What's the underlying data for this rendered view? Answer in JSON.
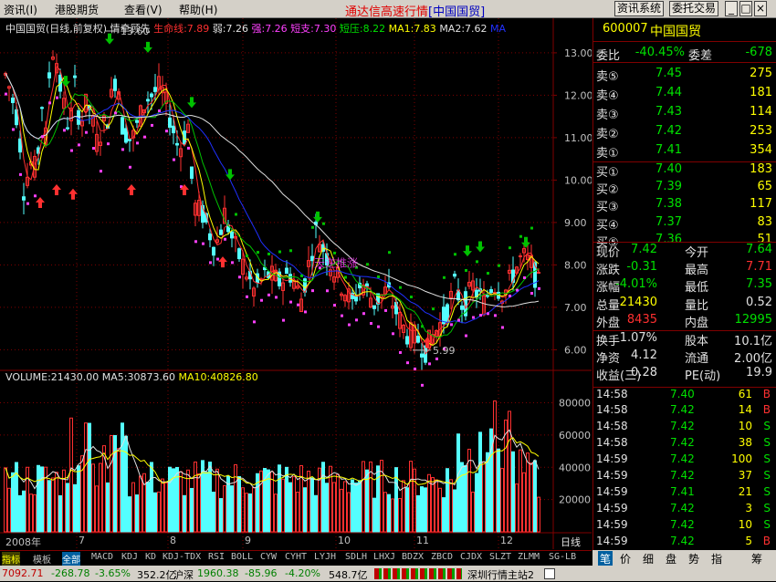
{
  "menu": {
    "items": [
      "资讯(I)",
      "港股期货",
      "查看(V)",
      "帮助(H)"
    ],
    "title": "通达信高速行情",
    "title_tag": "[中国国贸]",
    "btn1": "资讯系统",
    "btn2": "委托交易"
  },
  "chart": {
    "info": {
      "name": "中国国贸(日线,前复权) 情牵顾先",
      "life": "生命线:7.89",
      "weak": "弱:7.26",
      "strong": "强:7.26",
      "short": "短支:7.30",
      "pressure": "短压:8.22",
      "ma1": "MA1:7.83",
      "ma2": "MA2:7.62",
      "ma3": "MA"
    },
    "vol": {
      "volume": "VOLUME:21430.00",
      "ma5": "MA5:30873.60",
      "ma10": "MA10:40826.80"
    },
    "price_ticks": [
      "13.00",
      "12.00",
      "11.00",
      "10.00",
      "9.00",
      "8.00",
      "7.00",
      "6.00"
    ],
    "vol_ticks": [
      "80000",
      "60000",
      "40000",
      "20000"
    ],
    "x_labels": [
      "2008年",
      "7",
      "8",
      "9",
      "10",
      "11",
      "12",
      "日线"
    ],
    "annotations": {
      "high": "13.60",
      "low": "5.99",
      "watermark": "天逆推涨"
    }
  },
  "chart_data": {
    "type": "candlestick",
    "x_labels": [
      "2008年",
      "7",
      "8",
      "9",
      "10",
      "11",
      "12"
    ],
    "price_range": [
      5.6,
      13.6
    ],
    "volume_range": [
      0,
      95000
    ],
    "last": {
      "close": 7.42,
      "volume": 21430,
      "vol_ma5": 30873.6,
      "vol_ma10": 40826.8
    },
    "high": 13.6,
    "low": 5.99
  },
  "bottom_tabs": [
    "指标",
    "模板",
    "全部",
    "MACD",
    "KDJ",
    "KD",
    "KDJ-TDX",
    "RSI",
    "BOLL",
    "CYW",
    "CYHT",
    "LYJH",
    "SDLH",
    "LHXJ",
    "BDZX",
    "ZBCD",
    "CJDX",
    "SLZT",
    "ZLMM",
    "SG-LB"
  ],
  "quote": {
    "code": "600007",
    "name": "中国国贸",
    "wb_label": "委比",
    "wb": "-40.45%",
    "wc_label": "委差",
    "wc": "-678",
    "asks": [
      {
        "l": "卖⑤",
        "p": "7.45",
        "v": "275"
      },
      {
        "l": "卖④",
        "p": "7.44",
        "v": "181"
      },
      {
        "l": "卖③",
        "p": "7.43",
        "v": "114"
      },
      {
        "l": "卖②",
        "p": "7.42",
        "v": "253"
      },
      {
        "l": "卖①",
        "p": "7.41",
        "v": "354"
      }
    ],
    "bids": [
      {
        "l": "买①",
        "p": "7.40",
        "v": "183"
      },
      {
        "l": "买②",
        "p": "7.39",
        "v": "65"
      },
      {
        "l": "买③",
        "p": "7.38",
        "v": "117"
      },
      {
        "l": "买④",
        "p": "7.37",
        "v": "83"
      },
      {
        "l": "买⑤",
        "p": "7.36",
        "v": "51"
      }
    ],
    "stats": [
      {
        "a": "现价",
        "av": "7.42",
        "b": "今开",
        "bv": "7.64"
      },
      {
        "a": "涨跌",
        "av": "-0.31",
        "b": "最高",
        "bv": "7.71"
      },
      {
        "a": "涨幅",
        "av": "-4.01%",
        "b": "最低",
        "bv": "7.35"
      },
      {
        "a": "总量",
        "av": "21430",
        "b": "量比",
        "bv": "0.52"
      },
      {
        "a": "外盘",
        "av": "8435",
        "b": "内盘",
        "bv": "12995"
      }
    ],
    "stats2": [
      {
        "a": "换手",
        "av": "1.07%",
        "b": "股本",
        "bv": "10.1亿"
      },
      {
        "a": "净资",
        "av": "4.12",
        "b": "流通",
        "bv": "2.00亿"
      },
      {
        "a": "收益(三)",
        "av": "0.28",
        "b": "PE(动)",
        "bv": "19.9"
      }
    ],
    "ticks": [
      {
        "t": "14:58",
        "p": "7.40",
        "v": "61",
        "s": "B"
      },
      {
        "t": "14:58",
        "p": "7.42",
        "v": "14",
        "s": "B"
      },
      {
        "t": "14:58",
        "p": "7.42",
        "v": "10",
        "s": "S"
      },
      {
        "t": "14:58",
        "p": "7.42",
        "v": "38",
        "s": "S"
      },
      {
        "t": "14:59",
        "p": "7.42",
        "v": "100",
        "s": "S"
      },
      {
        "t": "14:59",
        "p": "7.42",
        "v": "37",
        "s": "S"
      },
      {
        "t": "14:59",
        "p": "7.41",
        "v": "21",
        "s": "S"
      },
      {
        "t": "14:59",
        "p": "7.42",
        "v": "3",
        "s": "S"
      },
      {
        "t": "14:59",
        "p": "7.42",
        "v": "10",
        "s": "S"
      },
      {
        "t": "14:59",
        "p": "7.42",
        "v": "5",
        "s": "B"
      }
    ]
  },
  "rp_tabs": [
    "笔",
    "价",
    "细",
    "盘",
    "势",
    "指",
    "筹"
  ],
  "status": {
    "idx1": "7092.71",
    "idx1_chg": "-268.78",
    "idx1_pct": "-3.65%",
    "idx1_amt": "352.2亿",
    "idx2_label": "沪深",
    "idx2": "1960.38",
    "idx2_chg": "-85.96",
    "idx2_pct": "-4.20%",
    "idx2_amt": "548.7亿",
    "server": "深圳行情主站2"
  },
  "colors": {
    "up": "#ff3030",
    "down": "#54ffff",
    "ma_white": "#e0e0e0",
    "ma_yellow": "#ffff00",
    "ma_blue": "#2030ff",
    "ma_green": "#00c000",
    "dot_magenta": "#ff40ff",
    "dot_green": "#00c000",
    "grid_red": "#800000"
  }
}
